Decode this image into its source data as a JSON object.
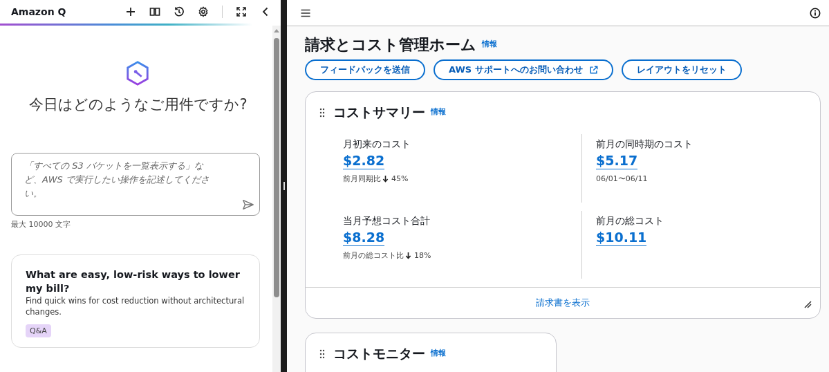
{
  "assistant": {
    "title": "Amazon Q",
    "greeting": "今日はどのようなご用件ですか?",
    "prompt": {
      "placeholder": "「すべての S3 バケットを一覧表示する」など、AWS で実行したい操作を記述してください。"
    },
    "char_limit": "最大 10000 文字",
    "suggestions": [
      {
        "title": "What are easy, low-risk ways to lower my bill?",
        "description": "Find quick wins for cost reduction without architectural changes.",
        "tag": "Q&A"
      }
    ]
  },
  "page": {
    "title": "請求とコスト管理ホーム",
    "info_link": "情報",
    "buttons": [
      {
        "label": "フィードバックを送信",
        "external": false
      },
      {
        "label": "AWS サポートへのお問い合わせ",
        "external": true
      },
      {
        "label": "レイアウトをリセット",
        "external": false
      }
    ],
    "summary": {
      "title": "コストサマリー",
      "info_link": "情報",
      "metrics": [
        {
          "label": "月初来のコスト",
          "value": "$2.82",
          "note": "前月同期比",
          "decrease": true,
          "change": "45%"
        },
        {
          "label": "前月の同時期のコスト",
          "value": "$5.17",
          "note": "06/01〜06/11"
        },
        {
          "label": "当月予想コスト合計",
          "value": "$8.28",
          "note": "前月の総コスト比",
          "decrease": true,
          "change": "18%"
        },
        {
          "label": "前月の総コスト",
          "value": "$10.11"
        }
      ],
      "footer_link": "請求書を表示"
    },
    "monitor": {
      "title": "コストモニター",
      "info_link": "情報"
    }
  }
}
